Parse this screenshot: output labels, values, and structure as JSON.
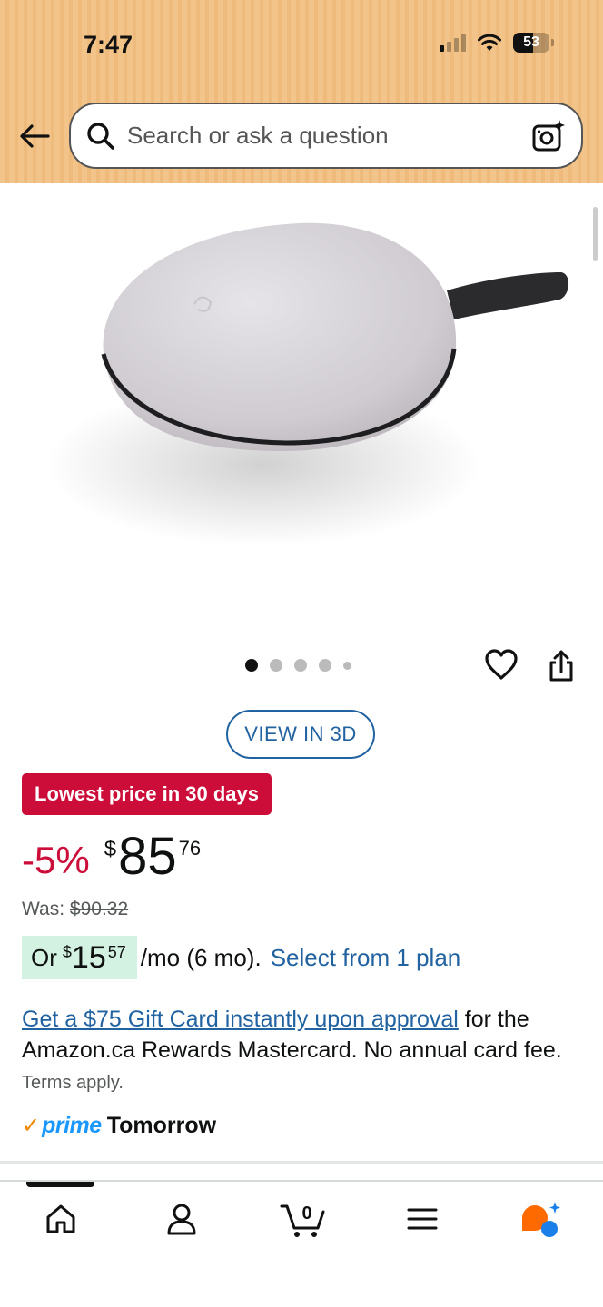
{
  "status_bar": {
    "time": "7:47",
    "battery": "53"
  },
  "search": {
    "placeholder": "Search or ask a question"
  },
  "product": {
    "image_alt": "Grey felt oval earbuds case with black wrist strap"
  },
  "carousel": {
    "total_dots": 5,
    "active_index": 0
  },
  "view_3d_label": "VIEW IN 3D",
  "deal_badge": "Lowest price in 30 days",
  "price": {
    "discount": "-5%",
    "currency": "$",
    "whole": "85",
    "fraction": "76",
    "was_label": "Was:",
    "was_price": "$90.32"
  },
  "plan": {
    "prefix": "Or",
    "currency": "$",
    "whole": "15",
    "fraction": "57",
    "suffix": "/mo (6 mo).",
    "link": "Select from 1 plan"
  },
  "promo": {
    "link": "Get a $75 Gift Card instantly upon approval",
    "text": "for the Amazon.ca Rewards Mastercard. No annual card fee.",
    "terms": "Terms apply."
  },
  "prime": {
    "brand": "prime",
    "delivery": "Tomorrow"
  },
  "bottom_nav": {
    "cart_count": "0"
  },
  "colors": {
    "header_bg": "#f3c48a",
    "deal_red": "#cc0c39",
    "link_blue": "#2162a1",
    "plan_green": "#d3f2e1",
    "prime_blue": "#1a98ff",
    "prime_orange": "#f08804",
    "rufus_orange": "#ff6a00",
    "rufus_blue": "#1a7fe8"
  }
}
